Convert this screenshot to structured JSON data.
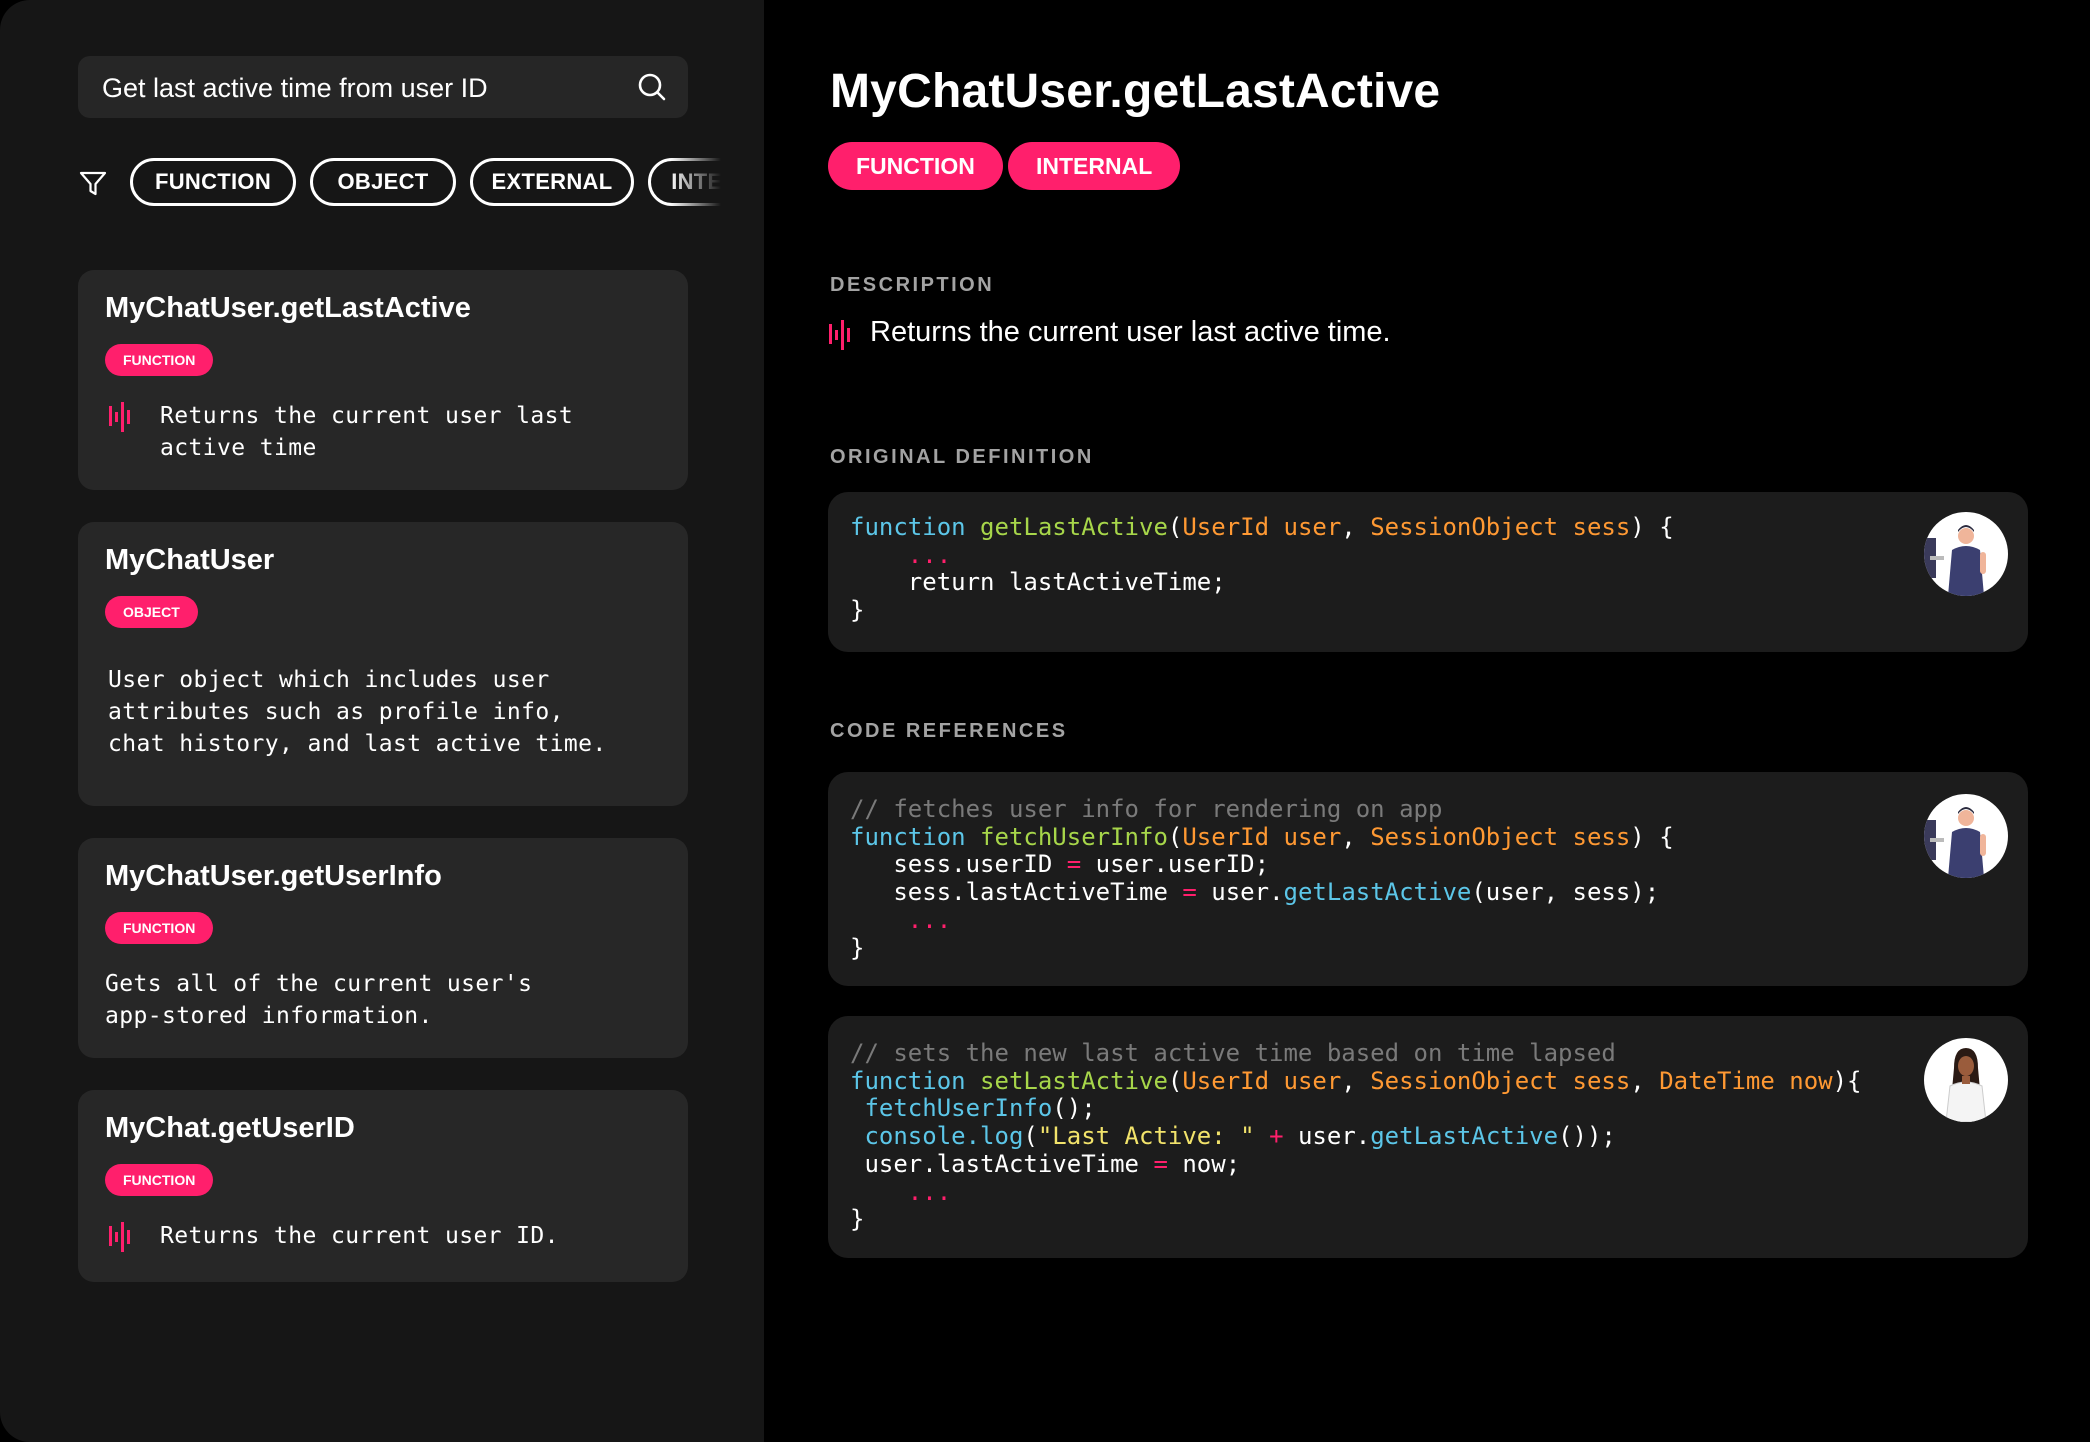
{
  "search": {
    "value": "Get last active time from user ID",
    "icon": "search-icon"
  },
  "filters": {
    "icon": "filter-icon",
    "chips": [
      "FUNCTION",
      "OBJECT",
      "EXTERNAL",
      "INTERNAL"
    ]
  },
  "results": [
    {
      "title": "MyChatUser.getLastActive",
      "tag": "FUNCTION",
      "desc": "Returns the current user last\nactive time",
      "ai_icon": true
    },
    {
      "title": "MyChatUser",
      "tag": "OBJECT",
      "desc": "User object which includes user\nattributes such as profile info,\nchat history, and last active time.",
      "ai_icon": false
    },
    {
      "title": "MyChatUser.getUserInfo",
      "tag": "FUNCTION",
      "desc": "Gets all of the current user's\napp-stored information.",
      "ai_icon": false
    },
    {
      "title": "MyChat.getUserID",
      "tag": "FUNCTION",
      "desc": "Returns the current user ID.",
      "ai_icon": true
    }
  ],
  "detail": {
    "title": "MyChatUser.getLastActive",
    "tags": [
      "FUNCTION",
      "INTERNAL"
    ],
    "description_label": "DESCRIPTION",
    "description": "Returns the current user last active time.",
    "definition_label": "ORIGINAL DEFINITION",
    "references_label": "CODE REFERENCES",
    "definition_code": {
      "l1_kw": "function",
      "l1_fn": "getLastActive",
      "l1_p1": "UserId user",
      "l1_p2": "SessionObject sess",
      "ellipsis": "...",
      "l3": "return lastActiveTime;"
    },
    "ref1": {
      "comment": "// fetches user info for rendering on app",
      "kw": "function",
      "fn": "fetchUserInfo",
      "p1": "UserId user",
      "p2": "SessionObject sess",
      "l3_a": "sess.userID",
      "l3_b": "user.userID;",
      "l4_a": "sess.lastActiveTime",
      "l4_b": "user.",
      "l4_call": "getLastActive",
      "l4_c": "(user, sess);",
      "ellipsis": "..."
    },
    "ref2": {
      "comment": "// sets the new last active time based on time lapsed",
      "kw": "function",
      "fn": "setLastActive",
      "p1": "UserId user",
      "p2": "SessionObject sess",
      "p3": "DateTime now",
      "l3_call": "fetchUserInfo",
      "l3_b": "();",
      "l4_call": "console.log",
      "l4_str": "\"Last Active: \"",
      "l4_b": "user.",
      "l4_call2": "getLastActive",
      "l4_c": "());",
      "l5_a": "user.lastActiveTime",
      "l5_b": "now;",
      "ellipsis": "..."
    }
  },
  "colors": {
    "accent": "#ff1f6c",
    "keyword": "#5cc6e8",
    "function_name": "#a7d64a",
    "type": "#ff9933",
    "comment": "#7a7a7a",
    "string": "#f2e36b"
  }
}
